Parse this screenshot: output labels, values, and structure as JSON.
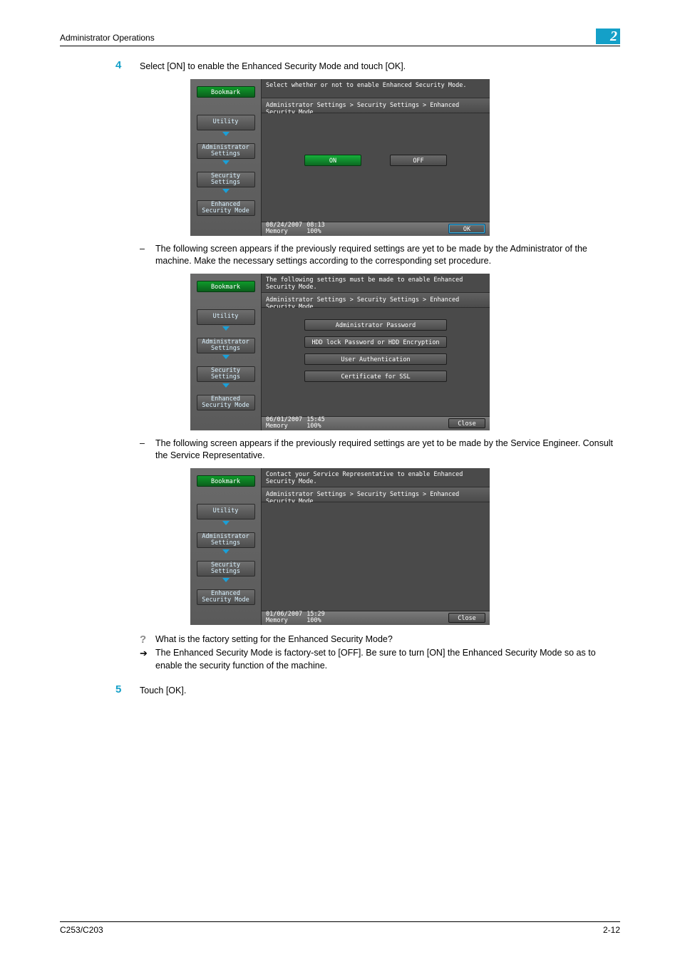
{
  "header": {
    "title": "Administrator Operations",
    "chapter": "2"
  },
  "step4": {
    "num": "4",
    "text": "Select [ON] to enable the Enhanced Security Mode and touch [OK]."
  },
  "panel1": {
    "msg": "Select whether or not to enable Enhanced Security Mode.",
    "path": "Administrator Settings > Security Settings > Enhanced Security Mode",
    "bookmark": "Bookmark",
    "crumbs": {
      "c1": "Utility",
      "c2": "Administrator Settings",
      "c3": "Security Settings",
      "c4": "Enhanced Security Mode"
    },
    "on": "ON",
    "off": "OFF",
    "date": "08/24/2007",
    "time": "08:13",
    "mem_l": "Memory",
    "mem_v": "100%",
    "ok": "OK"
  },
  "sub1": {
    "bullet": "–",
    "text": "The following screen appears if the previously required settings are yet to be made by the Administrator of the machine. Make the necessary settings according to the corresponding set procedure."
  },
  "panel2": {
    "msg": "The following settings must be made to enable Enhanced Security Mode.",
    "path": "Administrator Settings > Security Settings > Enhanced Security Mode",
    "bookmark": "Bookmark",
    "crumbs": {
      "c1": "Utility",
      "c2": "Administrator Settings",
      "c3": "Security Settings",
      "c4": "Enhanced Security Mode"
    },
    "s1": "Administrator Password",
    "s2": "HDD lock Password or HDD Encryption",
    "s3": "User Authentication",
    "s4": "Certificate for SSL",
    "date": "06/01/2007",
    "time": "15:45",
    "mem_l": "Memory",
    "mem_v": "100%",
    "close": "Close"
  },
  "sub2": {
    "bullet": "–",
    "text": "The following screen appears if the previously required settings are yet to be made by the Service Engineer. Consult the Service Representative."
  },
  "panel3": {
    "msg": "Contact your Service Representative to enable Enhanced Security Mode.",
    "path": "Administrator Settings > Security Settings > Enhanced Security Mode",
    "bookmark": "Bookmark",
    "crumbs": {
      "c1": "Utility",
      "c2": "Administrator Settings",
      "c3": "Security Settings",
      "c4": "Enhanced Security Mode"
    },
    "date": "01/06/2007",
    "time": "15:29",
    "mem_l": "Memory",
    "mem_v": "100%",
    "close": "Close"
  },
  "qa": {
    "q": "What is the factory setting for the Enhanced Security Mode?",
    "a": "The Enhanced Security Mode is factory-set to [OFF]. Be sure to turn [ON] the Enhanced Security Mode so as to enable the security function of the machine."
  },
  "step5": {
    "num": "5",
    "text": "Touch [OK]."
  },
  "footer": {
    "left": "C253/C203",
    "right": "2-12"
  }
}
